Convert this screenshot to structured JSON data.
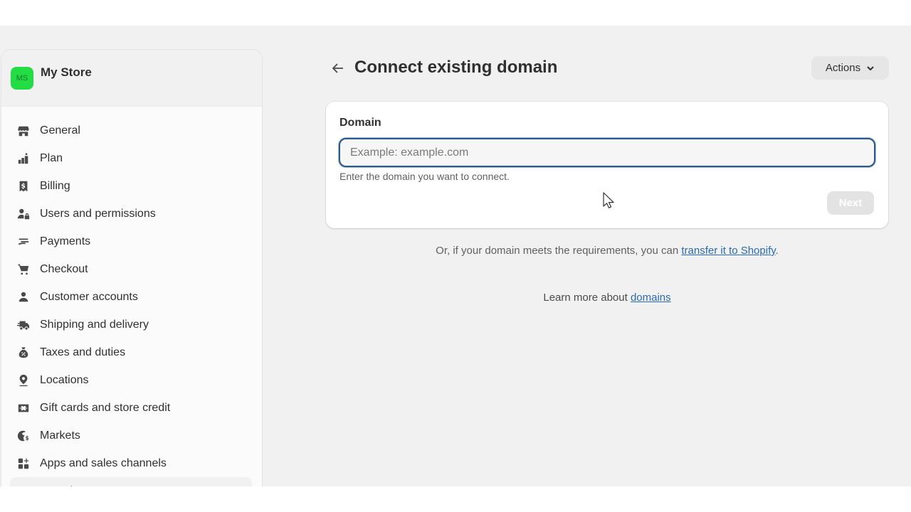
{
  "store": {
    "initials": "MS",
    "name": "My Store",
    "avatar_color": "#22dd44"
  },
  "sidebar": {
    "items": [
      {
        "label": "General",
        "icon": "store-icon"
      },
      {
        "label": "Plan",
        "icon": "plan-icon"
      },
      {
        "label": "Billing",
        "icon": "receipt-icon"
      },
      {
        "label": "Users and permissions",
        "icon": "users-lock-icon"
      },
      {
        "label": "Payments",
        "icon": "payments-icon"
      },
      {
        "label": "Checkout",
        "icon": "cart-icon"
      },
      {
        "label": "Customer accounts",
        "icon": "person-icon"
      },
      {
        "label": "Shipping and delivery",
        "icon": "truck-icon"
      },
      {
        "label": "Taxes and duties",
        "icon": "tax-bag-icon"
      },
      {
        "label": "Locations",
        "icon": "location-pin-icon"
      },
      {
        "label": "Gift cards and store credit",
        "icon": "gift-card-icon"
      },
      {
        "label": "Markets",
        "icon": "globe-dollar-icon"
      },
      {
        "label": "Apps and sales channels",
        "icon": "apps-icon"
      },
      {
        "label": "Domains",
        "icon": "domain-icon",
        "active": true
      }
    ]
  },
  "header": {
    "back_icon": "arrow-left-icon",
    "title": "Connect existing domain",
    "actions_label": "Actions"
  },
  "form": {
    "label": "Domain",
    "input_value": "",
    "input_placeholder": "Example: example.com",
    "help_text": "Enter the domain you want to connect.",
    "next_label": "Next",
    "next_disabled": true
  },
  "transfer": {
    "text": "Or, if your domain meets the requirements, you can ",
    "link": "transfer it to Shopify",
    "suffix": "."
  },
  "learn_more": {
    "text": "Learn more about ",
    "link": "domains"
  },
  "colors": {
    "accent_focus": "#2c5a8c",
    "link": "#2a6bb0",
    "background": "#f1f1f1"
  }
}
